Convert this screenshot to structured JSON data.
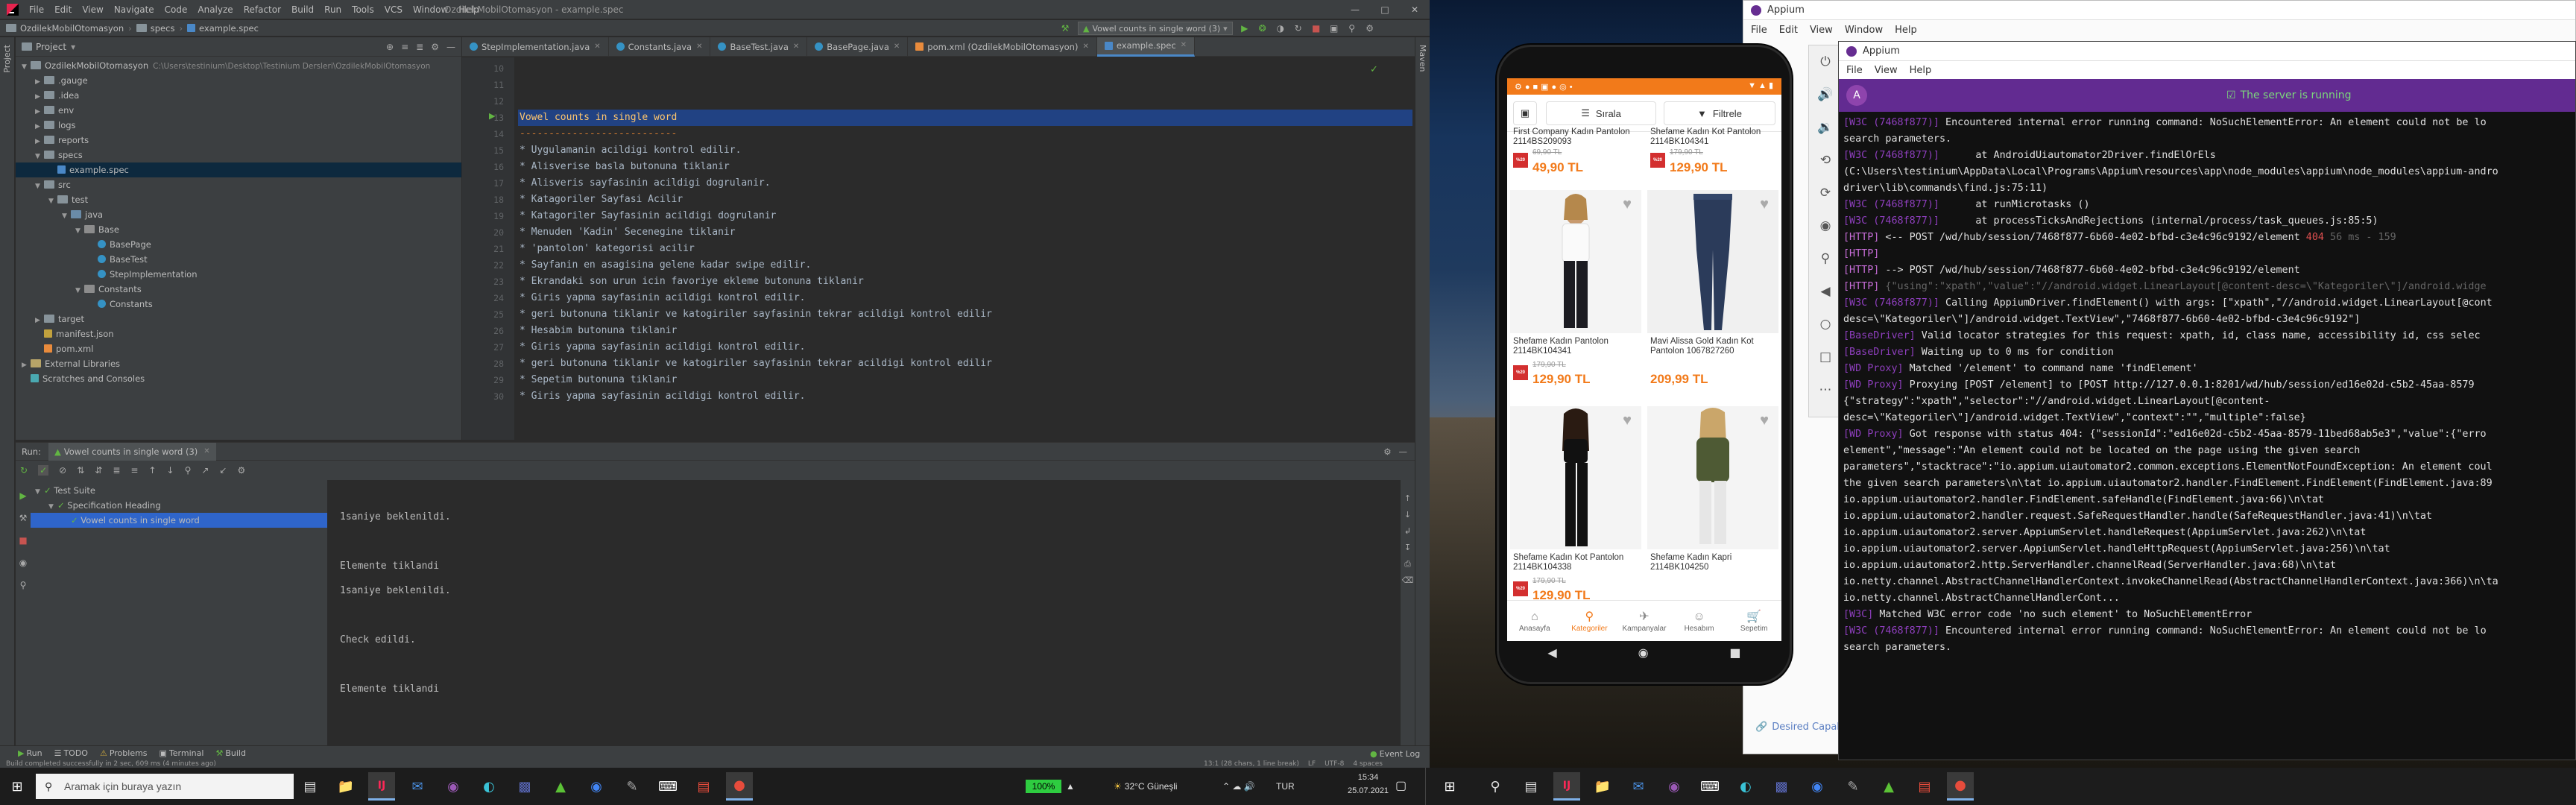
{
  "ide": {
    "menu": [
      "File",
      "Edit",
      "View",
      "Navigate",
      "Code",
      "Analyze",
      "Refactor",
      "Build",
      "Run",
      "Tools",
      "VCS",
      "Window",
      "Help"
    ],
    "window_title": "OzdilekMobilOtomasyon - example.spec",
    "breadcrumb": [
      "OzdilekMobilOtomasyon",
      "specs",
      "example.spec"
    ],
    "run_config": "Vowel counts in single word (3)",
    "project_label": "Project",
    "tree": [
      {
        "label": "OzdilekMobilOtomasyon",
        "extra": "C:\\Users\\testinium\\Desktop\\Testinium Dersleri\\OzdilekMobilOtomasyon",
        "level": 0,
        "type": "dir",
        "open": true
      },
      {
        "label": ".gauge",
        "level": 1,
        "type": "dir",
        "open": false
      },
      {
        "label": ".idea",
        "level": 1,
        "type": "dir",
        "open": false
      },
      {
        "label": "env",
        "level": 1,
        "type": "dir",
        "open": false
      },
      {
        "label": "logs",
        "level": 1,
        "type": "dir",
        "open": false
      },
      {
        "label": "reports",
        "level": 1,
        "type": "dir",
        "open": false
      },
      {
        "label": "specs",
        "level": 1,
        "type": "dir",
        "open": true
      },
      {
        "label": "example.spec",
        "level": 2,
        "type": "spec",
        "selected": true
      },
      {
        "label": "src",
        "level": 1,
        "type": "dir",
        "open": true
      },
      {
        "label": "test",
        "level": 2,
        "type": "dir",
        "open": true
      },
      {
        "label": "java",
        "level": 3,
        "type": "src",
        "open": true
      },
      {
        "label": "Base",
        "level": 4,
        "type": "pkg",
        "open": true
      },
      {
        "label": "BasePage",
        "level": 5,
        "type": "cls"
      },
      {
        "label": "BaseTest",
        "level": 5,
        "type": "cls"
      },
      {
        "label": "StepImplementation",
        "level": 5,
        "type": "cls"
      },
      {
        "label": "Constants",
        "level": 4,
        "type": "pkg",
        "open": true
      },
      {
        "label": "Constants",
        "level": 5,
        "type": "cls"
      },
      {
        "label": "target",
        "level": 1,
        "type": "dir",
        "open": false
      },
      {
        "label": "manifest.json",
        "level": 1,
        "type": "json"
      },
      {
        "label": "pom.xml",
        "level": 1,
        "type": "xml"
      },
      {
        "label": "External Libraries",
        "level": 0,
        "type": "lib",
        "open": false
      },
      {
        "label": "Scratches and Consoles",
        "level": 0,
        "type": "scr"
      }
    ],
    "tabs": [
      "StepImplementation.java",
      "Constants.java",
      "BaseTest.java",
      "BasePage.java",
      "pom.xml (OzdilekMobilOtomasyon)",
      "example.spec"
    ],
    "active_tab": 5,
    "code_lines": [
      {
        "n": "10",
        "t": ""
      },
      {
        "n": "11",
        "t": ""
      },
      {
        "n": "12",
        "t": ""
      },
      {
        "n": "13",
        "t": "Vowel counts in single word",
        "hl": true
      },
      {
        "n": "14",
        "t": "---------------------------"
      },
      {
        "n": "15",
        "t": "* Uygulamanin acildigi kontrol edilir."
      },
      {
        "n": "16",
        "t": "* Alisverise basla butonuna tiklanir"
      },
      {
        "n": "17",
        "t": "* Alisveris sayfasinin acildigi dogrulanir."
      },
      {
        "n": "18",
        "t": "* Katagoriler Sayfasi Acilir"
      },
      {
        "n": "19",
        "t": "* Katagoriler Sayfasinin acildigi dogrulanir"
      },
      {
        "n": "20",
        "t": "* Menuden 'Kadin' Secenegine tiklanir"
      },
      {
        "n": "21",
        "t": "* 'pantolon' kategorisi acilir"
      },
      {
        "n": "22",
        "t": "* Sayfanin en asagisina gelene kadar swipe edilir."
      },
      {
        "n": "23",
        "t": "* Ekrandaki son urun icin favoriye ekleme butonuna tiklanir"
      },
      {
        "n": "24",
        "t": "* Giris yapma sayfasinin acildigi kontrol edilir."
      },
      {
        "n": "25",
        "t": "* geri butonuna tiklanir ve katogiriler sayfasinin tekrar acildigi kontrol edilir"
      },
      {
        "n": "26",
        "t": "* Hesabim butonuna tiklanir"
      },
      {
        "n": "27",
        "t": "* Giris yapma sayfasinin acildigi kontrol edilir."
      },
      {
        "n": "28",
        "t": "* geri butonuna tiklanir ve katogiriler sayfasinin tekrar acildigi kontrol edilir"
      },
      {
        "n": "29",
        "t": "* Sepetim butonuna tiklanir"
      },
      {
        "n": "30",
        "t": "* Giris yapma sayfasinin acildigi kontrol edilir."
      }
    ],
    "run_tab_label": "Run:",
    "run_tab_name": "Vowel counts in single word (3)",
    "run_tree": [
      {
        "label": "Test Suite",
        "level": 0
      },
      {
        "label": "Specification Heading",
        "level": 1
      },
      {
        "label": "Vowel counts in single word",
        "level": 2,
        "selected": true
      }
    ],
    "run_output": [
      "",
      "1saniye beklenildi.",
      "",
      "Elemente tiklandi",
      "1saniye beklenildi.",
      "",
      "Check edildi.",
      "",
      "Elemente tiklandi"
    ],
    "bottom_tabs": [
      "Run",
      "TODO",
      "Problems",
      "Terminal",
      "Build"
    ],
    "event_log": "Event Log",
    "status_left": "Build completed successfully in 2 sec, 609 ms (4 minutes ago)",
    "status_right": [
      "13:1 (28 chars, 1 line break)",
      "LF",
      "UTF-8",
      "4 spaces"
    ]
  },
  "phone": {
    "top_buttons": {
      "sort": "Sırala",
      "filter": "Filtrele"
    },
    "partial_row": [
      {
        "name": "First Company Kadın Pantolon 2114BS209093",
        "old": "69,90 TL",
        "price": "49,90 TL"
      },
      {
        "name": "Shefame Kadın Kot Pantolon 2114BK104341",
        "old": "179,90 TL",
        "price": "129,90 TL"
      }
    ],
    "products": [
      {
        "name": "Shefame Kadın Pantolon 2114BK104341",
        "old": "179,90 TL",
        "price": "129,90 TL",
        "tag": true
      },
      {
        "name": "Mavi Alissa Gold Kadın Kot Pantolon 1067827260",
        "old": "",
        "price": "209,99 TL",
        "tag": false
      },
      {
        "name": "Shefame Kadın Kot Pantolon 2114BK104338",
        "old": "179,90 TL",
        "price": "129,90 TL",
        "tag": true
      },
      {
        "name": "Shefame Kadın Kapri 2114BK104250",
        "old": "",
        "price": "",
        "tag": false
      }
    ],
    "nav": [
      "Anasayfa",
      "Kategoriler",
      "Kampanyalar",
      "Hesabım",
      "Sepetim"
    ],
    "nav_active": 1,
    "accent": "#f27a1a"
  },
  "appium_back": {
    "title": "Appium",
    "menu": [
      "File",
      "Edit",
      "View",
      "Window",
      "Help"
    ],
    "footer": "Desired Capabilities Documentation"
  },
  "appium": {
    "title": "Appium",
    "menu": [
      "File",
      "View",
      "Help"
    ],
    "banner": "The server is running",
    "banner_color": "#622b91",
    "log": [
      [
        {
          "c": "pre",
          "t": "[W3C (7468f877)]"
        },
        {
          "t": " Encountered internal error running command: NoSuchElementError: An element could not be lo"
        }
      ],
      [
        {
          "t": "search parameters."
        }
      ],
      [
        {
          "c": "pre",
          "t": "[W3C (7468f877)]"
        },
        {
          "t": "      at AndroidUiautomator2Driver.findElOrEls"
        }
      ],
      [
        {
          "t": "(C:\\Users\\testinium\\AppData\\Local\\Programs\\Appium\\resources\\app\\node_modules\\appium\\node_modules\\appium-andro"
        }
      ],
      [
        {
          "t": "driver\\lib\\commands\\find.js:75:11)"
        }
      ],
      [
        {
          "c": "pre",
          "t": "[W3C (7468f877)]"
        },
        {
          "t": "      at runMicrotasks ()"
        }
      ],
      [
        {
          "c": "pre",
          "t": "[W3C (7468f877)]"
        },
        {
          "t": "      at processTicksAndRejections (internal/process/task_queues.js:85:5)"
        }
      ],
      [
        {
          "c": "http",
          "t": "[HTTP]"
        },
        {
          "t": " <-- POST /wd/hub/session/7468f877-6b60-4e02-bfbd-c3e4c96c9192/element "
        },
        {
          "c": "st",
          "t": "404"
        },
        {
          "c": "dim",
          "t": " 56 ms - 159"
        }
      ],
      [
        {
          "c": "http",
          "t": "[HTTP]"
        }
      ],
      [
        {
          "c": "http",
          "t": "[HTTP]"
        },
        {
          "t": " --> POST /wd/hub/session/7468f877-6b60-4e02-bfbd-c3e4c96c9192/element"
        }
      ],
      [
        {
          "c": "http",
          "t": "[HTTP]"
        },
        {
          "c": "dim",
          "t": " {\"using\":\"xpath\",\"value\":\"//android.widget.LinearLayout[@content-desc=\\\"Kategoriler\\\"]/android.widge"
        }
      ],
      [
        {
          "c": "pre",
          "t": "[W3C (7468f877)]"
        },
        {
          "t": " Calling AppiumDriver.findElement() with args: [\"xpath\",\"//android.widget.LinearLayout[@cont"
        }
      ],
      [
        {
          "t": "desc=\\\"Kategoriler\\\"]/android.widget.TextView\",\"7468f877-6b60-4e02-bfbd-c3e4c96c9192\"]"
        }
      ],
      [
        {
          "c": "pre",
          "t": "[BaseDriver]"
        },
        {
          "t": " Valid locator strategies for this request: xpath, id, class name, accessibility id, css selec"
        }
      ],
      [
        {
          "c": "pre",
          "t": "[BaseDriver]"
        },
        {
          "t": " Waiting up to 0 ms for condition"
        }
      ],
      [
        {
          "c": "pre",
          "t": "[WD Proxy]"
        },
        {
          "t": " Matched '/element' to command name 'findElement'"
        }
      ],
      [
        {
          "c": "pre",
          "t": "[WD Proxy]"
        },
        {
          "t": " Proxying [POST /element] to [POST http://127.0.0.1:8201/wd/hub/session/ed16e02d-c5b2-45aa-8579"
        }
      ],
      [
        {
          "t": "{\"strategy\":\"xpath\",\"selector\":\"//android.widget.LinearLayout[@content-"
        }
      ],
      [
        {
          "t": "desc=\\\"Kategoriler\\\"]/android.widget.TextView\",\"context\":\"\",\"multiple\":false}"
        }
      ],
      [
        {
          "c": "pre",
          "t": "[WD Proxy]"
        },
        {
          "t": " Got response with status 404: {\"sessionId\":\"ed16e02d-c5b2-45aa-8579-11bed68ab5e3\",\"value\":{\"erro"
        }
      ],
      [
        {
          "t": "element\",\"message\":\"An element could not be located on the page using the given search"
        }
      ],
      [
        {
          "t": "parameters\",\"stacktrace\":\"io.appium.uiautomator2.common.exceptions.ElementNotFoundException: An element coul"
        }
      ],
      [
        {
          "t": "the given search parameters\\n\\tat io.appium.uiautomator2.handler.FindElement.FindElement(FindElement.java:89"
        }
      ],
      [
        {
          "t": "io.appium.uiautomator2.handler.FindElement.safeHandle(FindElement.java:66)\\n\\tat"
        }
      ],
      [
        {
          "t": "io.appium.uiautomator2.handler.request.SafeRequestHandler.handle(SafeRequestHandler.java:41)\\n\\tat"
        }
      ],
      [
        {
          "t": "io.appium.uiautomator2.server.AppiumServlet.handleRequest(AppiumServlet.java:262)\\n\\tat"
        }
      ],
      [
        {
          "t": "io.appium.uiautomator2.server.AppiumServlet.handleHttpRequest(AppiumServlet.java:256)\\n\\tat"
        }
      ],
      [
        {
          "t": "io.appium.uiautomator2.http.ServerHandler.channelRead(ServerHandler.java:68)\\n\\tat"
        }
      ],
      [
        {
          "t": "io.netty.channel.AbstractChannelHandlerContext.invokeChannelRead(AbstractChannelHandlerContext.java:366)\\n\\ta"
        }
      ],
      [
        {
          "t": "io.netty.channel.AbstractChannelHandlerCont..."
        }
      ],
      [
        {
          "c": "pre",
          "t": "[W3C]"
        },
        {
          "t": " Matched W3C error code 'no such element' to NoSuchElementError"
        }
      ],
      [
        {
          "c": "pre",
          "t": "[W3C (7468f877)]"
        },
        {
          "t": " Encountered internal error running command: NoSuchElementError: An element could not be lo"
        }
      ],
      [
        {
          "t": "search parameters."
        }
      ]
    ]
  },
  "taskbar": {
    "search_placeholder": "Aramak için buraya yazın",
    "battery": "100%",
    "weather": "32°C  Güneşli",
    "lang": "TUR",
    "time": "15:34",
    "date": "25.07.2021"
  }
}
